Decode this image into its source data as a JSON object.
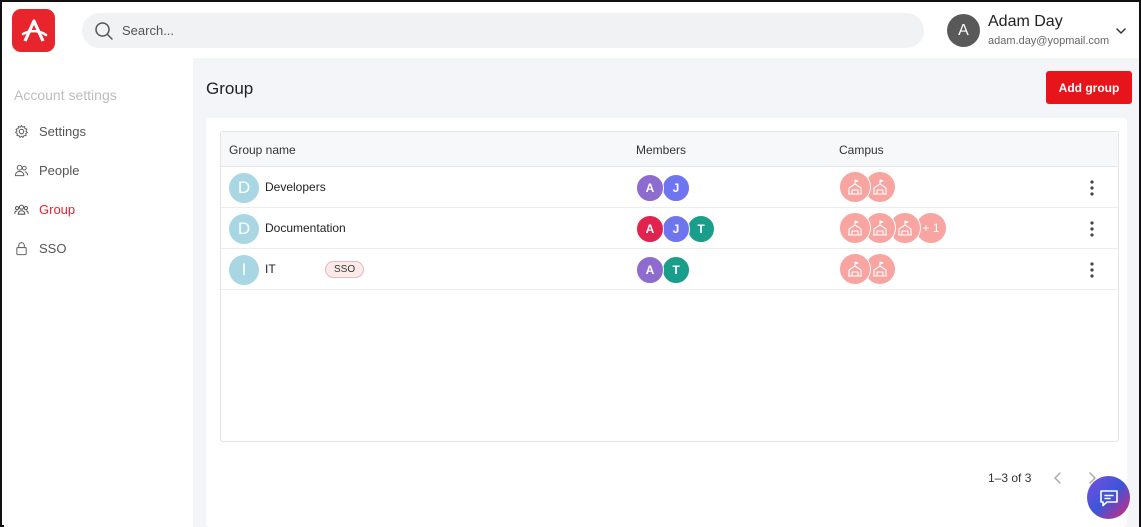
{
  "app": {
    "logo_icon": "brand-logo-icon",
    "accent_color": "#e8242c"
  },
  "search": {
    "placeholder": "Search..."
  },
  "user": {
    "initial": "A",
    "name": "Adam Day",
    "email": "adam.day@yopmail.com"
  },
  "sidebar": {
    "heading": "Account settings",
    "items": [
      {
        "label": "Settings",
        "icon": "gear-icon",
        "active": false
      },
      {
        "label": "People",
        "icon": "people-icon",
        "active": false
      },
      {
        "label": "Group",
        "icon": "group-icon",
        "active": true
      },
      {
        "label": "SSO",
        "icon": "lock-icon",
        "active": false
      }
    ]
  },
  "main": {
    "title": "Group",
    "add_button": "Add group",
    "table": {
      "columns": [
        "Group name",
        "Members",
        "Campus"
      ],
      "rows": [
        {
          "initial": "D",
          "name": "Developers",
          "tag": "",
          "members": [
            "A",
            "J"
          ],
          "campus_count": 2,
          "campus_more": ""
        },
        {
          "initial": "D",
          "name": "Documentation",
          "tag": "",
          "members": [
            "A",
            "J",
            "T"
          ],
          "campus_count": 3,
          "campus_more": "+ 1"
        },
        {
          "initial": "I",
          "name": "IT",
          "tag": "SSO",
          "members": [
            "A",
            "T"
          ],
          "campus_count": 2,
          "campus_more": ""
        }
      ]
    },
    "pagination": {
      "text": "1–3 of 3"
    }
  },
  "member_colors": {
    "A_purple": "#8e6ccf",
    "J": "#6f74ef",
    "T": "#1a9e8c",
    "A_red": "#e0244f"
  }
}
